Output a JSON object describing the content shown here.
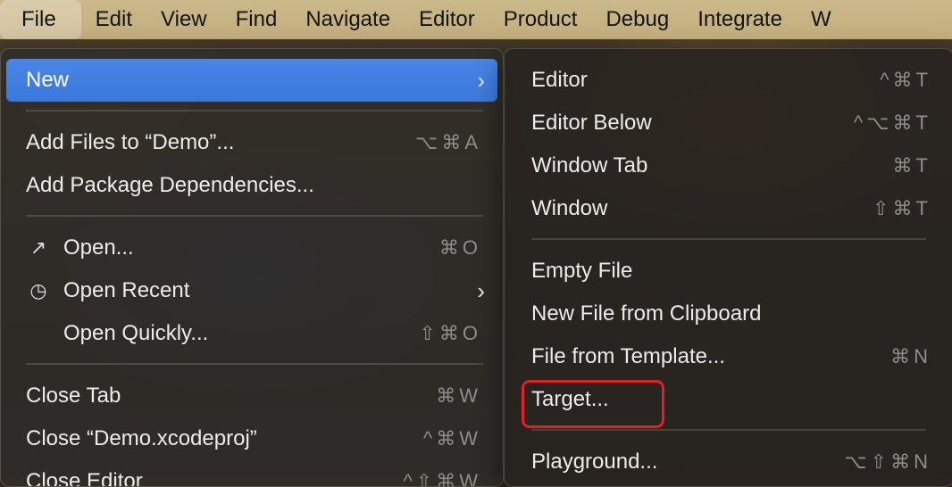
{
  "menubar": {
    "items": [
      "File",
      "Edit",
      "View",
      "Find",
      "Navigate",
      "Editor",
      "Product",
      "Debug",
      "Integrate",
      "W"
    ]
  },
  "file_menu": {
    "items": [
      {
        "label": "New",
        "shortcut": "",
        "submenu": true,
        "highlighted": true
      },
      {
        "label": "Add Files to “Demo”...",
        "shortcut": "⌥⌘A"
      },
      {
        "label": "Add Package Dependencies...",
        "shortcut": ""
      },
      {
        "label": "Open...",
        "shortcut": "⌘O",
        "icon": "arrow-up-right-icon"
      },
      {
        "label": "Open Recent",
        "shortcut": "",
        "submenu": true,
        "icon": "clock-icon"
      },
      {
        "label": "Open Quickly...",
        "shortcut": "⇧⌘O"
      },
      {
        "label": "Close Tab",
        "shortcut": "⌘W"
      },
      {
        "label": "Close “Demo.xcodeproj”",
        "shortcut": "^⌘W"
      },
      {
        "label": "Close Editor",
        "shortcut": "^⇧⌘W"
      }
    ]
  },
  "new_submenu": {
    "items": [
      {
        "label": "Editor",
        "shortcut": "^⌘T"
      },
      {
        "label": "Editor Below",
        "shortcut": "^⌥⌘T"
      },
      {
        "label": "Window Tab",
        "shortcut": "⌘T"
      },
      {
        "label": "Window",
        "shortcut": "⇧⌘T"
      },
      {
        "label": "Empty File",
        "shortcut": ""
      },
      {
        "label": "New File from Clipboard",
        "shortcut": ""
      },
      {
        "label": "File from Template...",
        "shortcut": "⌘N"
      },
      {
        "label": "Target...",
        "shortcut": "",
        "annotated": true
      },
      {
        "label": "Playground...",
        "shortcut": "⌥⇧⌘N"
      }
    ]
  },
  "colors": {
    "highlight": "#3b78dc",
    "annotation": "#e02222",
    "menubar": "#c9b584"
  }
}
